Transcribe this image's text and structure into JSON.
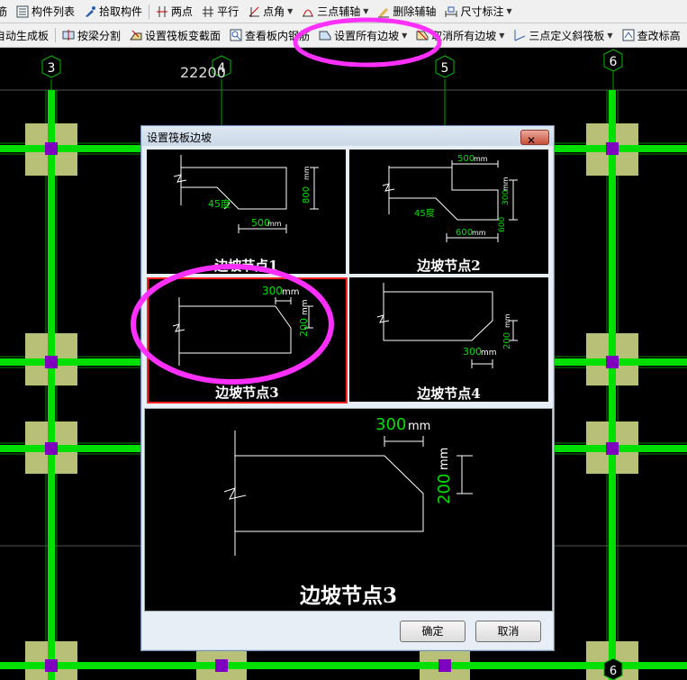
{
  "toolbar1": {
    "items": [
      {
        "label": "筋",
        "icon": "none"
      },
      {
        "label": "构件列表",
        "icon": "list-icon"
      },
      {
        "label": "拾取构件",
        "icon": "pick-icon"
      },
      {
        "label": "两点",
        "icon": "two-point-axis-icon"
      },
      {
        "label": "平行",
        "icon": "parallel-axis-icon"
      },
      {
        "label": "点角",
        "icon": "point-angle-icon"
      },
      {
        "label": "三点辅轴",
        "icon": "three-point-axis-icon"
      },
      {
        "label": "删除辅轴",
        "icon": "delete-axis-icon"
      },
      {
        "label": "尺寸标注",
        "icon": "dimension-icon"
      }
    ]
  },
  "toolbar2": {
    "items": [
      {
        "label": "自动生成板",
        "icon": "none"
      },
      {
        "label": "按梁分割",
        "icon": "split-by-beam-icon"
      },
      {
        "label": "设置筏板变截面",
        "icon": "variable-section-icon"
      },
      {
        "label": "查看板内钢筋",
        "icon": "view-rebar-icon"
      },
      {
        "label": "设置所有边坡",
        "icon": "set-slope-icon"
      },
      {
        "label": "取消所有边坡",
        "icon": "cancel-slope-icon"
      },
      {
        "label": "三点定义斜筏板",
        "icon": "three-point-slab-icon"
      },
      {
        "label": "查改标高",
        "icon": "elevation-icon"
      }
    ]
  },
  "canvas": {
    "axis_labels": [
      "3",
      "4",
      "5",
      "6"
    ],
    "bottom_axis_label": "6",
    "dimension_text": "22200"
  },
  "dialog": {
    "title": "设置筏板边坡",
    "close_symbol": "✕",
    "thumbnails": [
      {
        "label": "边坡节点1",
        "texts": {
          "angle": "45度",
          "width": "500",
          "height": "800",
          "unit": "mm"
        }
      },
      {
        "label": "边坡节点2",
        "texts": {
          "angle": "45度",
          "top": "500",
          "side1": "300",
          "side2": "600",
          "bottom": "600",
          "unit": "mm"
        }
      },
      {
        "label": "边坡节点3",
        "texts": {
          "width": "300",
          "height": "200",
          "unit": "mm"
        }
      },
      {
        "label": "边坡节点4",
        "texts": {
          "width": "300",
          "height": "200",
          "unit": "mm"
        }
      }
    ],
    "selected_index": 2,
    "preview": {
      "label": "边坡节点3",
      "width": "300",
      "height": "200",
      "unit": "mm"
    },
    "ok_label": "确定",
    "cancel_label": "取消"
  },
  "colors": {
    "grid": "#00e000",
    "column": "#b8c078",
    "marker": "#8000c0",
    "annotation": "#ff40ff",
    "selected_border": "#ff2020"
  }
}
